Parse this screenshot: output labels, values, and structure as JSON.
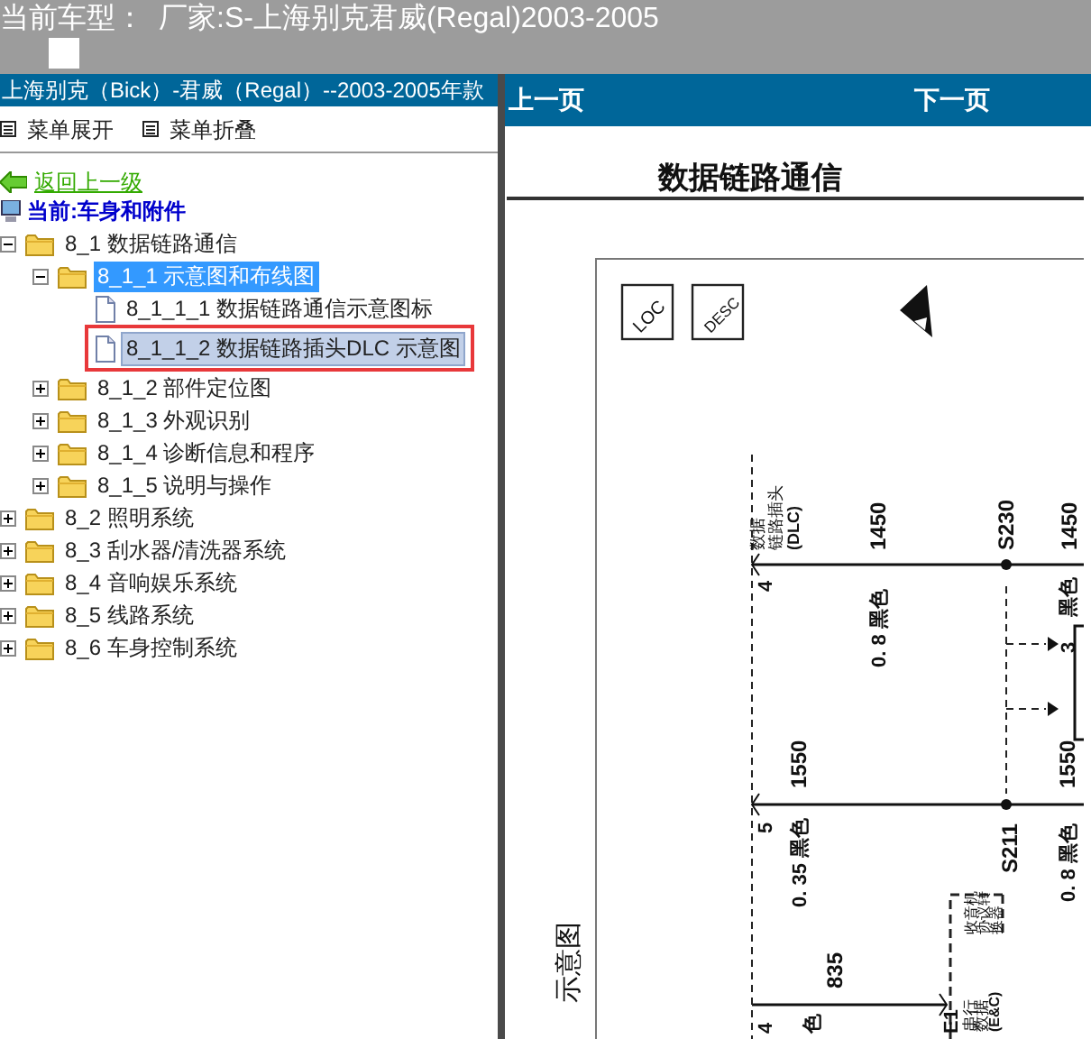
{
  "top_bar": {
    "label": "当前车型：",
    "vehicle": "厂家:S-上海别克君威(Regal)2003-2005"
  },
  "left_panel": {
    "title": "上海别克（Bick）-君威（Regal）--2003-2005年款",
    "toolbar": [
      "菜单展开",
      "菜单折叠"
    ],
    "back_link": "返回上一级",
    "current": "当前:车身和附件",
    "tree": [
      {
        "kind": "folder",
        "label": "8_1 数据链路通信",
        "expanded": true,
        "selected": false,
        "highlighted": false,
        "children": [
          {
            "kind": "folder",
            "label": "8_1_1 示意图和布线图",
            "expanded": true,
            "selected": true,
            "highlighted": false,
            "children": [
              {
                "kind": "page",
                "label": "8_1_1_1 数据链路通信示意图标",
                "selected": false,
                "highlighted": false
              },
              {
                "kind": "page",
                "label": "8_1_1_2 数据链路插头DLC 示意图",
                "selected": false,
                "highlighted": true
              }
            ]
          },
          {
            "kind": "folder",
            "label": "8_1_2 部件定位图",
            "expanded": false,
            "selected": false,
            "highlighted": false
          },
          {
            "kind": "folder",
            "label": "8_1_3 外观识别",
            "expanded": false,
            "selected": false,
            "highlighted": false
          },
          {
            "kind": "folder",
            "label": "8_1_4 诊断信息和程序",
            "expanded": false,
            "selected": false,
            "highlighted": false
          },
          {
            "kind": "folder",
            "label": "8_1_5 说明与操作",
            "expanded": false,
            "selected": false,
            "highlighted": false
          }
        ]
      },
      {
        "kind": "folder",
        "label": "8_2 照明系统",
        "expanded": false,
        "selected": false,
        "highlighted": false
      },
      {
        "kind": "folder",
        "label": "8_3 刮水器/清洗器系统",
        "expanded": false,
        "selected": false,
        "highlighted": false
      },
      {
        "kind": "folder",
        "label": "8_4 音响娱乐系统",
        "expanded": false,
        "selected": false,
        "highlighted": false
      },
      {
        "kind": "folder",
        "label": "8_5 线路系统",
        "expanded": false,
        "selected": false,
        "highlighted": false
      },
      {
        "kind": "folder",
        "label": "8_6 车身控制系统",
        "expanded": false,
        "selected": false,
        "highlighted": false
      }
    ]
  },
  "right_panel": {
    "prev": "上一页",
    "next": "下一页",
    "document": {
      "title": "数据链路通信",
      "badges": [
        "LOC",
        "DESC"
      ],
      "labels": [
        "数据",
        "链路插头",
        "(DLC)",
        "1450",
        "S230",
        "1450",
        "4",
        "0. 8 黑色",
        "黑色",
        "3",
        "1550",
        "5",
        "0. 35 黑色",
        "S211",
        "1550",
        "0. 8 黑色",
        "收音机",
        "协议转",
        "换器",
        "835",
        "示意图",
        "E1",
        "串行",
        "数据",
        "(E&C)",
        "4",
        "色"
      ]
    }
  }
}
